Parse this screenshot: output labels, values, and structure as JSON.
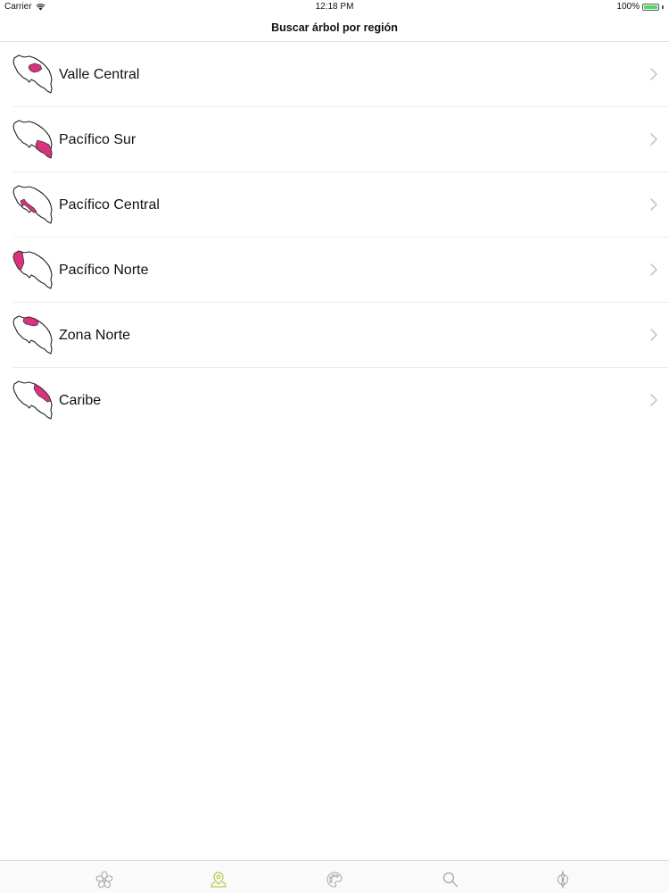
{
  "status_bar": {
    "carrier": "Carrier",
    "time": "12:18 PM",
    "battery": "100%",
    "battery_level": 1.0
  },
  "nav": {
    "title": "Buscar árbol por región"
  },
  "regions": [
    {
      "label": "Valle Central",
      "icon": "map-valle-central-icon"
    },
    {
      "label": "Pacífico Sur",
      "icon": "map-pacifico-sur-icon"
    },
    {
      "label": "Pacífico Central",
      "icon": "map-pacifico-central-icon"
    },
    {
      "label": "Pacífico Norte",
      "icon": "map-pacifico-norte-icon"
    },
    {
      "label": "Zona Norte",
      "icon": "map-zona-norte-icon"
    },
    {
      "label": "Caribe",
      "icon": "map-caribe-icon"
    }
  ],
  "tabs": [
    {
      "icon": "flower-icon",
      "selected": false
    },
    {
      "icon": "map-pin-icon",
      "selected": true
    },
    {
      "icon": "palette-icon",
      "selected": false
    },
    {
      "icon": "search-icon",
      "selected": false
    },
    {
      "icon": "compass-icon",
      "selected": false
    }
  ],
  "colors": {
    "highlight": "#d9337d",
    "tab_selected": "#b5c94a",
    "tab_inactive": "#a9a9a9",
    "chevron": "#c7c7cc"
  }
}
